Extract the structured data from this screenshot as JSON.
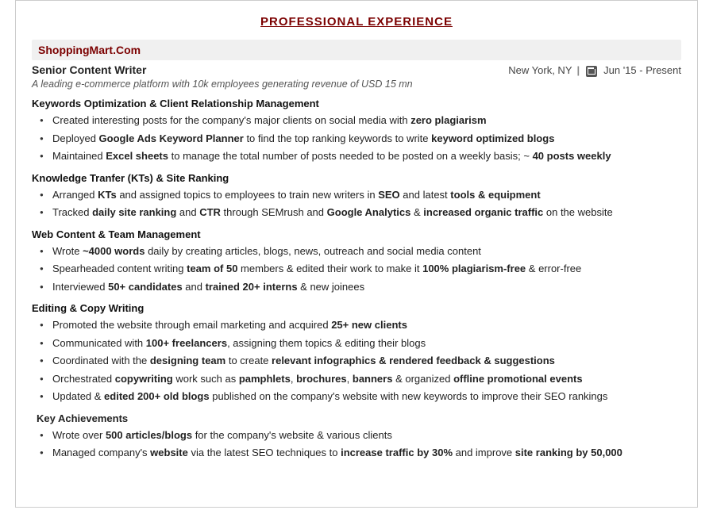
{
  "page": {
    "section_title": "PROFESSIONAL EXPERIENCE",
    "company": {
      "name": "ShoppingMart.Com",
      "job_title": "Senior Content Writer",
      "location": "New York, NY",
      "date_range": "Jun '15 - Present",
      "description": "A leading e-commerce platform with 10k employees generating revenue of USD 15 mn"
    },
    "subsections": [
      {
        "title": "Keywords Optimization & Client Relationship Management",
        "bullets": [
          "Created interesting posts for the company's major clients on social media with <b>zero plagiarism</b>",
          "Deployed <b>Google Ads Keyword Planner</b> to find the top ranking keywords to write <b>keyword optimized blogs</b>",
          "Maintained <b>Excel sheets</b> to manage the total number of posts needed to be posted on a weekly basis; ~ <b>40 posts weekly</b>"
        ]
      },
      {
        "title": "Knowledge Tranfer (KTs) & Site Ranking",
        "bullets": [
          "Arranged <b>KTs</b> and assigned topics to employees to train new writers in <b>SEO</b> and latest <b>tools & equipment</b>",
          "Tracked <b>daily site ranking</b> and <b>CTR</b> through SEMrush and <b>Google Analytics</b> & <b>increased organic traffic</b> on the website"
        ]
      },
      {
        "title": "Web Content & Team Management",
        "bullets": [
          "Wrote <b>~4000 words</b> daily by creating articles, blogs, news, outreach and social media content",
          "Spearheaded content writing <b>team of 50</b> members & edited their work to make it <b>100% plagiarism-free</b> & error-free",
          "Interviewed <b>50+ candidates</b> and <b>trained 20+ interns</b> & new joinees"
        ]
      },
      {
        "title": "Editing & Copy Writing",
        "bullets": [
          "Promoted the website through email marketing and acquired <b>25+ new clients</b>",
          "Communicated with <b>100+ freelancers</b>, assigning them topics & editing their blogs",
          "Coordinated with the <b>designing team</b> to create <b>relevant infographics & rendered feedback & suggestions</b>",
          "Orchestrated <b>copywriting</b> work such as <b>pamphlets</b>, <b>brochures</b>, <b>banners</b> & organized <b>offline promotional events</b>",
          "Updated & <b>edited 200+ old blogs</b> published on the company's website with new keywords to improve their SEO rankings"
        ]
      }
    ],
    "achievements": {
      "title": "Key Achievements",
      "bullets": [
        "Wrote over <b>500 articles/blogs</b> for the company's website & various clients",
        "Managed company's <b>website</b> via the latest SEO techniques to <b>increase traffic by 30%</b> and improve <b>site ranking by 50,000</b>"
      ]
    }
  }
}
